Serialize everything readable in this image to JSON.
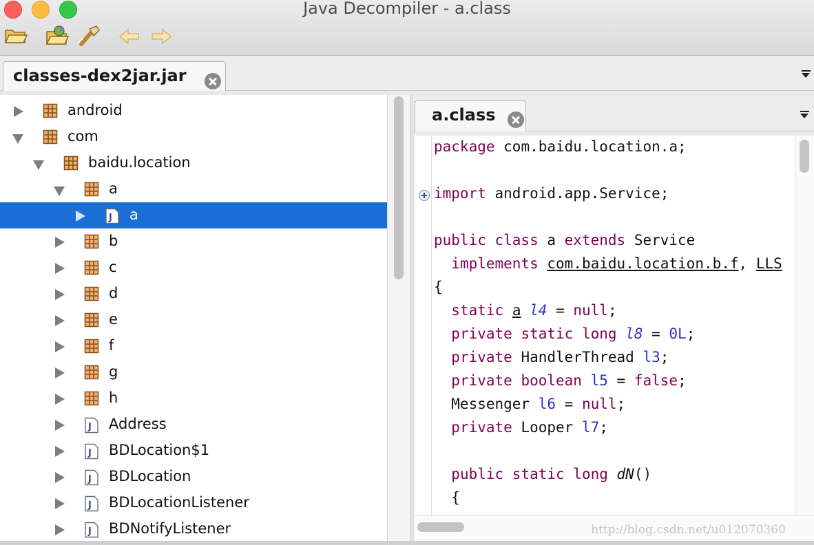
{
  "window": {
    "title": "Java Decompiler - a.class"
  },
  "toolbar": {
    "icons": [
      "open-folder-icon",
      "open-type-icon",
      "wrench-icon",
      "back-arrow-icon",
      "forward-arrow-icon"
    ]
  },
  "tabs": {
    "jar_tab": "classes-dex2jar.jar",
    "class_tab": "a.class"
  },
  "tree": {
    "items": [
      {
        "label": "android",
        "kind": "package",
        "expanded": false,
        "depth": 0
      },
      {
        "label": "com",
        "kind": "package",
        "expanded": true,
        "depth": 0
      },
      {
        "label": "baidu.location",
        "kind": "package",
        "expanded": true,
        "depth": 1
      },
      {
        "label": "a",
        "kind": "package",
        "expanded": true,
        "depth": 2
      },
      {
        "label": "a",
        "kind": "class",
        "expanded": false,
        "depth": 3,
        "selected": true
      },
      {
        "label": "b",
        "kind": "package",
        "expanded": false,
        "depth": 2
      },
      {
        "label": "c",
        "kind": "package",
        "expanded": false,
        "depth": 2
      },
      {
        "label": "d",
        "kind": "package",
        "expanded": false,
        "depth": 2
      },
      {
        "label": "e",
        "kind": "package",
        "expanded": false,
        "depth": 2
      },
      {
        "label": "f",
        "kind": "package",
        "expanded": false,
        "depth": 2
      },
      {
        "label": "g",
        "kind": "package",
        "expanded": false,
        "depth": 2
      },
      {
        "label": "h",
        "kind": "package",
        "expanded": false,
        "depth": 2
      },
      {
        "label": "Address",
        "kind": "class",
        "expanded": false,
        "depth": 2
      },
      {
        "label": "BDLocation$1",
        "kind": "class",
        "expanded": false,
        "depth": 2
      },
      {
        "label": "BDLocation",
        "kind": "class",
        "expanded": false,
        "depth": 2
      },
      {
        "label": "BDLocationListener",
        "kind": "class",
        "expanded": false,
        "depth": 2
      },
      {
        "label": "BDNotifyListener",
        "kind": "class",
        "expanded": false,
        "depth": 2
      }
    ]
  },
  "code": {
    "lines": [
      [
        [
          "kw",
          "package"
        ],
        [
          "t",
          " com.baidu.location.a;"
        ]
      ],
      [],
      [
        [
          "kw",
          "import"
        ],
        [
          "t",
          " android.app.Service;"
        ]
      ],
      [],
      [
        [
          "kw",
          "public class"
        ],
        [
          "t",
          " a "
        ],
        [
          "kw",
          "extends"
        ],
        [
          "t",
          " Service"
        ]
      ],
      [
        [
          "t",
          "  "
        ],
        [
          "kw",
          "implements"
        ],
        [
          "t",
          " "
        ],
        [
          "ul",
          "com.baidu.location.b.f"
        ],
        [
          "t",
          ", "
        ],
        [
          "ul",
          "LLS"
        ]
      ],
      [
        [
          "t",
          "{"
        ]
      ],
      [
        [
          "t",
          "  "
        ],
        [
          "kw",
          "static"
        ],
        [
          "t",
          " "
        ],
        [
          "ul",
          "a"
        ],
        [
          "t",
          " "
        ],
        [
          "var",
          "l4"
        ],
        [
          "t",
          " = "
        ],
        [
          "lit",
          "null"
        ],
        [
          "t",
          ";"
        ]
      ],
      [
        [
          "t",
          "  "
        ],
        [
          "kw",
          "private static long"
        ],
        [
          "t",
          " "
        ],
        [
          "var",
          "l8"
        ],
        [
          "t",
          " = "
        ],
        [
          "num",
          "0L"
        ],
        [
          "t",
          ";"
        ]
      ],
      [
        [
          "t",
          "  "
        ],
        [
          "kw",
          "private"
        ],
        [
          "t",
          " HandlerThread "
        ],
        [
          "fld",
          "l3"
        ],
        [
          "t",
          ";"
        ]
      ],
      [
        [
          "t",
          "  "
        ],
        [
          "kw",
          "private boolean"
        ],
        [
          "t",
          " "
        ],
        [
          "fld",
          "l5"
        ],
        [
          "t",
          " = "
        ],
        [
          "lit",
          "false"
        ],
        [
          "t",
          ";"
        ]
      ],
      [
        [
          "t",
          "  Messenger "
        ],
        [
          "fld",
          "l6"
        ],
        [
          "t",
          " = "
        ],
        [
          "lit",
          "null"
        ],
        [
          "t",
          ";"
        ]
      ],
      [
        [
          "t",
          "  "
        ],
        [
          "kw",
          "private"
        ],
        [
          "t",
          " Looper "
        ],
        [
          "fld",
          "l7"
        ],
        [
          "t",
          ";"
        ]
      ],
      [],
      [
        [
          "t",
          "  "
        ],
        [
          "kw",
          "public static long"
        ],
        [
          "t",
          " "
        ],
        [
          "it",
          "dN"
        ],
        [
          "t",
          "()"
        ]
      ],
      [
        [
          "t",
          "  {"
        ]
      ]
    ]
  },
  "watermark": "http://blog.csdn.net/u012070360",
  "colors": {
    "selection": "#1a6fd7",
    "keyword": "#7f0055",
    "field": "#2a33c8"
  }
}
